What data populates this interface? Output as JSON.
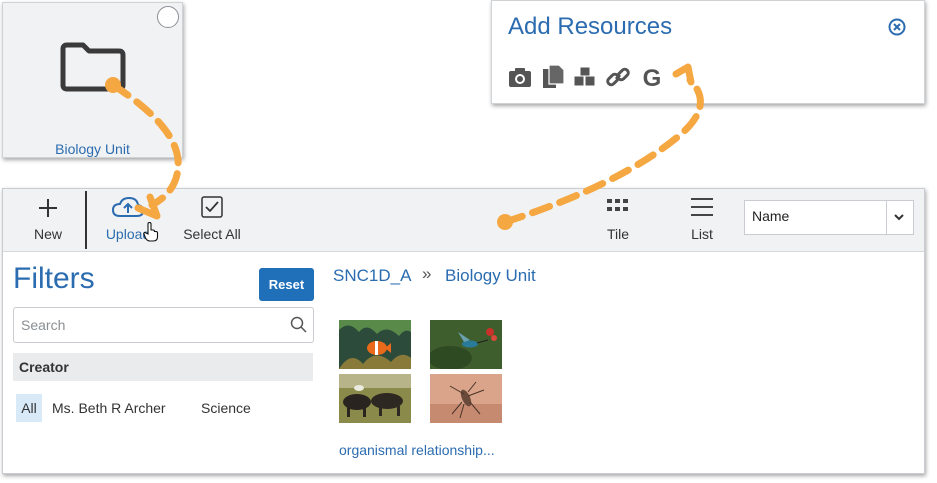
{
  "folder_card": {
    "name": "Biology Unit"
  },
  "add_resources": {
    "title": "Add Resources",
    "icons": [
      "camera-icon",
      "documents-icon",
      "cubes-icon",
      "link-icon",
      "google-icon"
    ]
  },
  "toolbar": {
    "new_label": "New",
    "upload_label": "Upload",
    "select_all_label": "Select All",
    "tile_label": "Tile",
    "list_label": "List",
    "sort_value": "Name"
  },
  "filters": {
    "title": "Filters",
    "reset_label": "Reset",
    "search_placeholder": "Search",
    "creator_heading": "Creator",
    "creator_options": [
      "All",
      "Ms. Beth R Archer",
      "Science"
    ]
  },
  "breadcrumb": {
    "root": "SNC1D_A",
    "separator": "»",
    "current": "Biology Unit"
  },
  "item": {
    "name": "organismal relationship..."
  },
  "colors": {
    "accent": "#2b6cb0",
    "button": "#1f6fb9",
    "annotation_arrow": "#f5a742"
  }
}
